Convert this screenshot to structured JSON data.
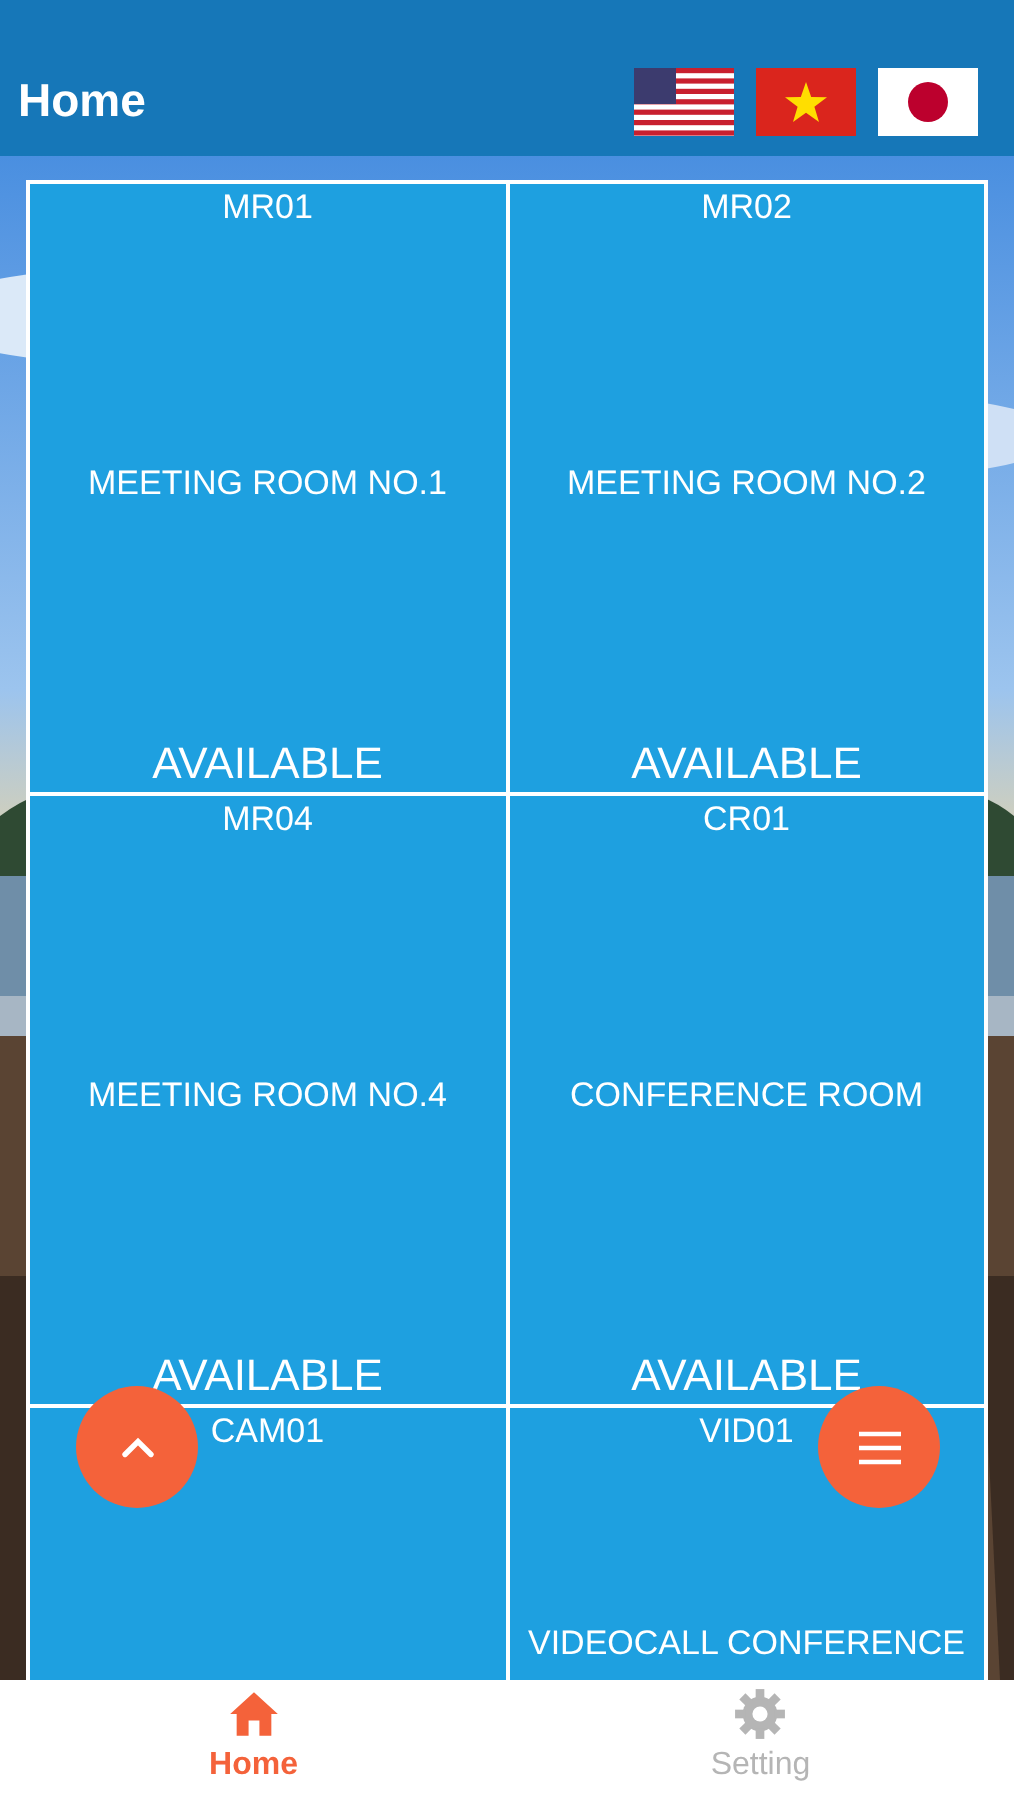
{
  "header": {
    "title": "Home",
    "languages": [
      {
        "kind": "us"
      },
      {
        "kind": "vn"
      },
      {
        "kind": "jp"
      }
    ]
  },
  "rooms": [
    {
      "code": "MR01",
      "name": "MEETING ROOM NO.1",
      "status": "AVAILABLE"
    },
    {
      "code": "MR02",
      "name": "MEETING ROOM NO.2",
      "status": "AVAILABLE"
    },
    {
      "code": "MR04",
      "name": "MEETING ROOM NO.4",
      "status": "AVAILABLE"
    },
    {
      "code": "CR01",
      "name": "CONFERENCE ROOM",
      "status": "AVAILABLE"
    },
    {
      "code": "CAM01"
    },
    {
      "code": "VID01",
      "name": "VIDEOCALL CONFERENCE"
    }
  ],
  "fabs": [
    {
      "kind": "up"
    },
    {
      "kind": "menu"
    }
  ],
  "tabs": [
    {
      "label": "Home",
      "kind": "home",
      "selected": true
    },
    {
      "label": "Setting",
      "kind": "gear",
      "selected": false
    }
  ]
}
